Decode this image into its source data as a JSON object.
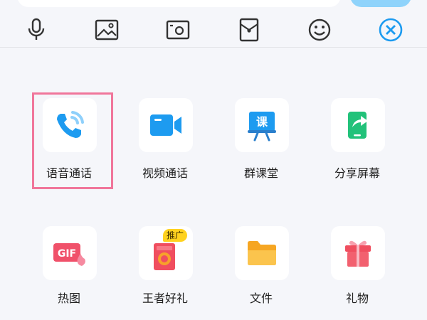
{
  "colors": {
    "accent": "#1d9bf0",
    "highlight": "#f0769b",
    "icon_dark": "#333333"
  },
  "toolbar": {
    "icons": [
      "microphone-icon",
      "image-icon",
      "camera-icon",
      "red-packet-icon",
      "emoji-icon",
      "close-icon"
    ]
  },
  "apps": [
    {
      "label": "语音通话",
      "icon": "phone-call-icon"
    },
    {
      "label": "视频通话",
      "icon": "video-camera-icon"
    },
    {
      "label": "群课堂",
      "icon": "class-board-icon",
      "icon_text": "课"
    },
    {
      "label": "分享屏幕",
      "icon": "share-screen-icon"
    },
    {
      "label": "热图",
      "icon": "gif-icon",
      "icon_text": "GIF"
    },
    {
      "label": "王者好礼",
      "icon": "game-gift-icon",
      "badge": "推广"
    },
    {
      "label": "文件",
      "icon": "folder-icon"
    },
    {
      "label": "礼物",
      "icon": "gift-box-icon"
    }
  ]
}
